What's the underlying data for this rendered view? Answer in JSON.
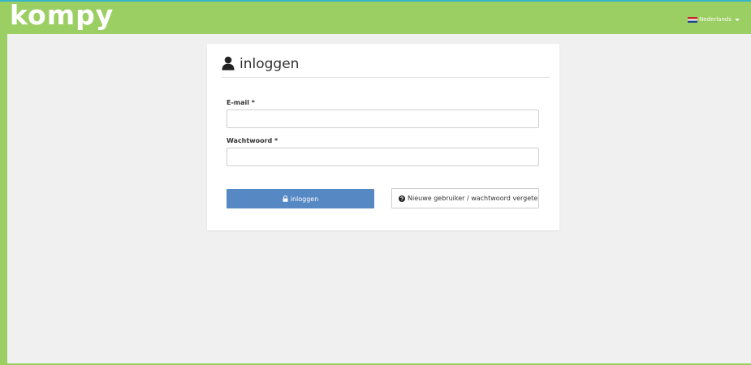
{
  "header": {
    "logo_text": "kompy",
    "language": "Nederlands",
    "brand_color": "#9ccf63",
    "accent_top": "#35b5c6"
  },
  "login": {
    "title": "inloggen",
    "email_label": "E-mail *",
    "email_value": "",
    "password_label": "Wachtwoord *",
    "password_value": "",
    "login_button": "inloggen",
    "new_user_button": "Nieuwe gebruiker / wachtwoord vergeten",
    "button_color": "#5688c4"
  },
  "icons": {
    "title_icon": "user-icon",
    "login_icon": "lock-icon",
    "help_icon": "question-circle-icon",
    "language_icon": "flag-nl-icon"
  }
}
